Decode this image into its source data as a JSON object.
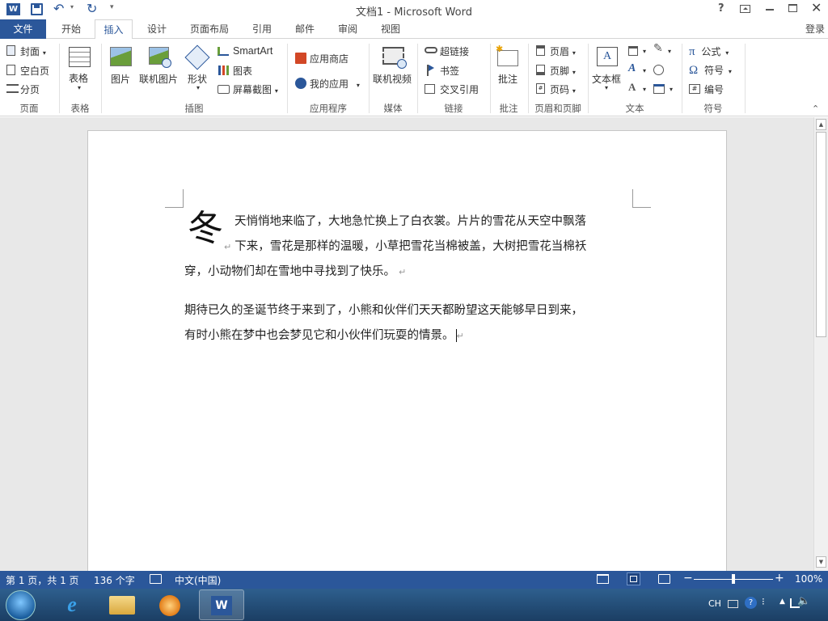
{
  "title_bar": {
    "title": "文档1 - Microsoft Word",
    "help_label": "?",
    "login_label": "登录"
  },
  "tabs": [
    {
      "label": "文件"
    },
    {
      "label": "开始"
    },
    {
      "label": "插入"
    },
    {
      "label": "设计"
    },
    {
      "label": "页面布局"
    },
    {
      "label": "引用"
    },
    {
      "label": "邮件"
    },
    {
      "label": "审阅"
    },
    {
      "label": "视图"
    }
  ],
  "ribbon": {
    "pages": {
      "cover": "封面",
      "blank": "空白页",
      "break": "分页",
      "group": "页面"
    },
    "table": {
      "label": "表格",
      "group": "表格"
    },
    "illustrations": {
      "pictures": "图片",
      "online_pictures": "联机图片",
      "shapes": "形状",
      "smartart": "SmartArt",
      "chart": "图表",
      "screenshot": "屏幕截图",
      "group": "插图"
    },
    "apps": {
      "store": "应用商店",
      "my_apps": "我的应用",
      "group": "应用程序"
    },
    "media": {
      "online_video": "联机视频",
      "group": "媒体"
    },
    "links": {
      "hyperlink": "超链接",
      "bookmark": "书签",
      "cross_ref": "交叉引用",
      "group": "链接"
    },
    "comments": {
      "comment": "批注",
      "group": "批注"
    },
    "header_footer": {
      "header": "页眉",
      "footer": "页脚",
      "page_number": "页码",
      "group": "页眉和页脚"
    },
    "text": {
      "textbox": "文本框",
      "group": "文本"
    },
    "symbols": {
      "equation": "公式",
      "symbol": "符号",
      "number": "编号",
      "group": "符号",
      "pi": "π",
      "omega": "Ω"
    }
  },
  "document": {
    "dropcap": "冬",
    "p1_line1": "天悄悄地来临了，大地急忙换上了白衣裳。片片的雪花从天空中飘落",
    "p1_line2": "下来，雪花是那样的温暖，小草把雪花当棉被盖，大树把雪花当棉袄",
    "p1_line3": "穿，小动物们却在雪地中寻找到了快乐。",
    "p2_line1": "期待已久的圣诞节终于来到了，小熊和伙伴们天天都盼望这天能够早日到来，",
    "p2_line2": "有时小熊在梦中也会梦见它和小伙伴们玩耍的情景。",
    "para_mark": "↵"
  },
  "status_bar": {
    "page": "第 1 页，共 1 页",
    "words": "136 个字",
    "language": "中文(中国)",
    "zoom": "100%",
    "zoom_level": 1.0
  },
  "taskbar": {
    "ime": "CH"
  },
  "colors": {
    "accent": "#2b579a",
    "taskbar": "#1f4a75"
  }
}
